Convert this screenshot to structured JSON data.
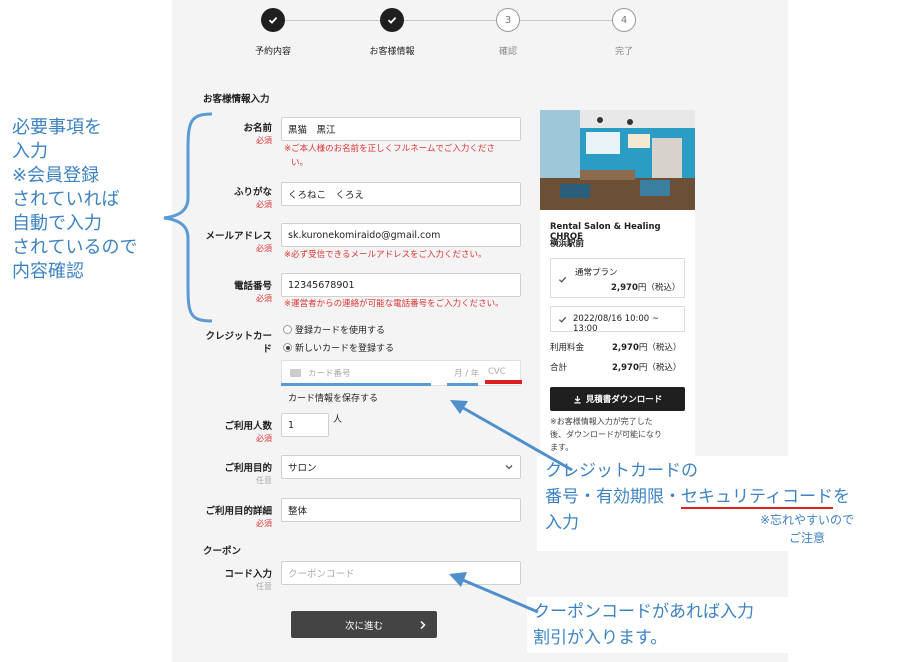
{
  "steps": [
    {
      "label": "予約内容",
      "number": "1",
      "done": true
    },
    {
      "label": "お客様情報",
      "number": "2",
      "done": true
    },
    {
      "label": "確認",
      "number": "3",
      "done": false
    },
    {
      "label": "完了",
      "number": "4",
      "done": false
    }
  ],
  "form": {
    "section_title": "お客様情報入力",
    "required_label": "必須",
    "optional_label": "任意",
    "name": {
      "label": "お名前",
      "value": "黒猫　黒江",
      "note_line1": "※ご本人様のお名前を正しくフルネームでご入力くださ",
      "note_line2": "い。"
    },
    "furigana": {
      "label": "ふりがな",
      "value": "くろねこ　くろえ"
    },
    "email": {
      "label": "メールアドレス",
      "value": "sk.kuronekomiraido@gmail.com",
      "note": "※必ず受信できるメールアドレスをご入力ください。"
    },
    "phone": {
      "label": "電話番号",
      "value": "12345678901",
      "note": "※運営者からの連絡が可能な電話番号をご入力ください。"
    },
    "credit": {
      "label_line1": "クレジットカー",
      "label_line2": "ド",
      "option_saved": "登録カードを使用する",
      "option_new": "新しいカードを登録する",
      "card_number_placeholder": "カード番号",
      "expiry_placeholder": "月 / 年",
      "cvc_placeholder": "CVC",
      "save_card_label": "カード情報を保存する"
    },
    "people": {
      "label": "ご利用人数",
      "value": "1",
      "unit": "人"
    },
    "purpose": {
      "label": "ご利用目的",
      "value": "サロン"
    },
    "purpose_detail": {
      "label": "ご利用目的詳細",
      "value": "整体"
    },
    "coupon_section": "クーポン",
    "coupon": {
      "label": "コード入力",
      "placeholder": "クーポンコード"
    },
    "next_button": "次に進む"
  },
  "sidebar": {
    "venue_name": "Rental Salon & Healing CHROE",
    "venue_area": "横浜駅前",
    "plan_name": "通常プラン",
    "plan_price": "2,970",
    "yen_tax": "円（税込）",
    "datetime": "2022/08/16 10:00 ~ 13:00",
    "fee_label": "利用料金",
    "fee_value": "2,970",
    "total_label": "合計",
    "total_value": "2,970",
    "download_button": "見積書ダウンロード",
    "download_note_lines": [
      "※お客様情報入力が完了した",
      "後、ダウンロードが可能になり",
      "ます。"
    ]
  },
  "annotations": {
    "left_lines": [
      "必要事項を",
      "入力",
      "※会員登録",
      "されていれば",
      "自動で入力",
      "されているので",
      "内容確認"
    ],
    "card_line1": "クレジットカードの",
    "card_line2_a": "番号・有効期限・",
    "card_line2_b": "セキュリティコード",
    "card_line2_c": "を",
    "card_line3": "入力",
    "card_note_line1": "※忘れやすいので",
    "card_note_line2": "ご注意",
    "coupon_line1": "クーポンコードがあれば入力",
    "coupon_line2": "割引が入ります。"
  },
  "colors": {
    "annotation_blue": "#3d83c2",
    "required_red": "#dd3333",
    "dark_button": "#1f1f1f"
  }
}
